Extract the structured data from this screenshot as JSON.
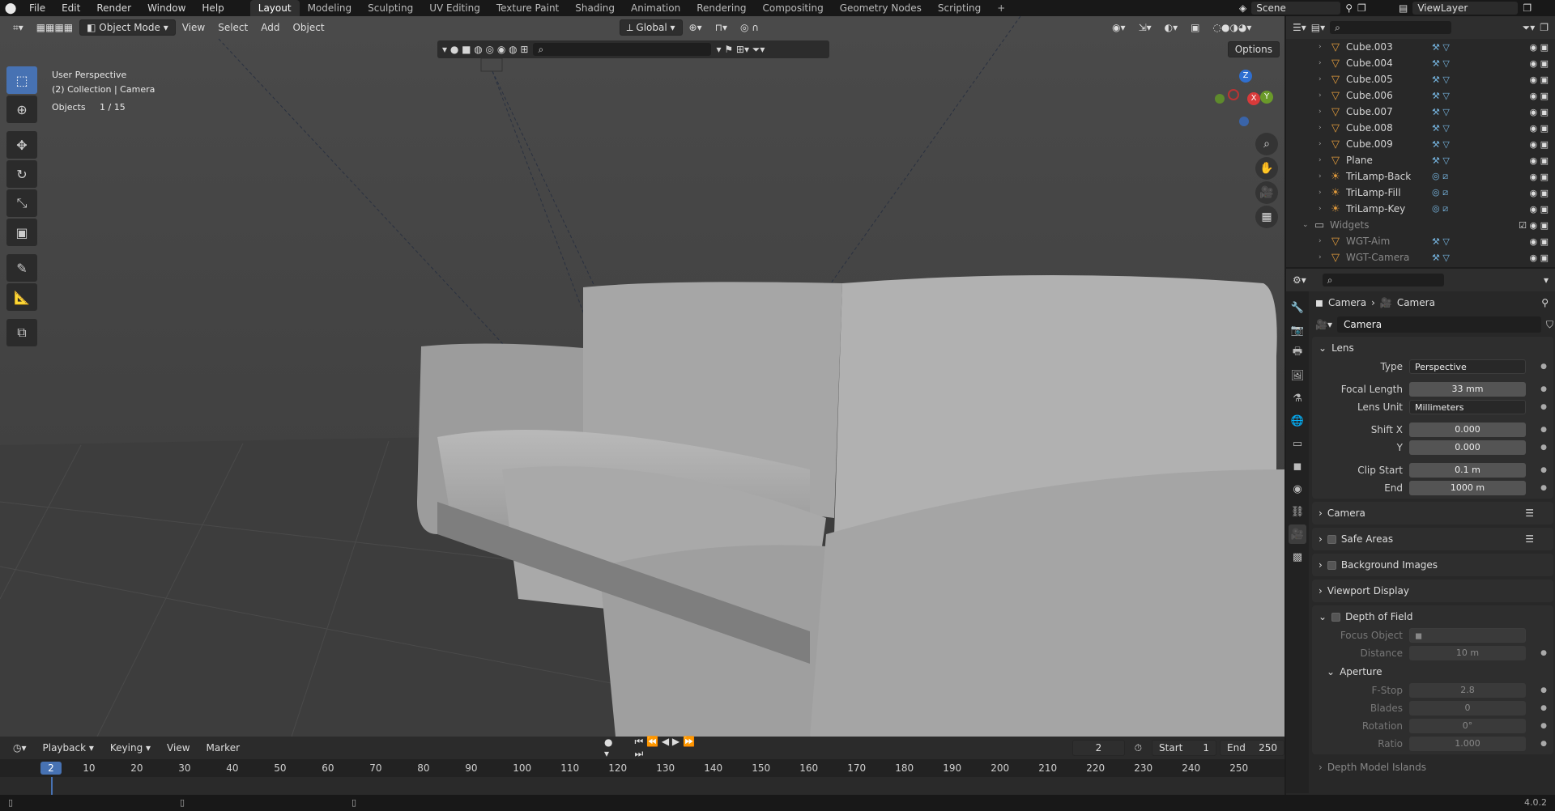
{
  "topbar": {
    "menus": [
      "File",
      "Edit",
      "Render",
      "Window",
      "Help"
    ],
    "workspaces": [
      "Layout",
      "Modeling",
      "Sculpting",
      "UV Editing",
      "Texture Paint",
      "Shading",
      "Animation",
      "Rendering",
      "Compositing",
      "Geometry Nodes",
      "Scripting"
    ],
    "active_workspace": "Layout",
    "scene": "Scene",
    "view_layer": "ViewLayer"
  },
  "viewport": {
    "mode": "Object Mode",
    "menus": [
      "View",
      "Select",
      "Add",
      "Object"
    ],
    "orientation": "Global",
    "overlay_text": {
      "perspective": "User Perspective",
      "context": "(2) Collection | Camera",
      "objects_label": "Objects",
      "objects_count": "1 / 15"
    },
    "options": "Options",
    "gizmo": {
      "z": "Z",
      "y": "Y",
      "x": "X"
    }
  },
  "outliner": {
    "rows": [
      {
        "name": "Cube.003",
        "kind": "mesh"
      },
      {
        "name": "Cube.004",
        "kind": "mesh"
      },
      {
        "name": "Cube.005",
        "kind": "mesh"
      },
      {
        "name": "Cube.006",
        "kind": "mesh"
      },
      {
        "name": "Cube.007",
        "kind": "mesh"
      },
      {
        "name": "Cube.008",
        "kind": "mesh"
      },
      {
        "name": "Cube.009",
        "kind": "mesh"
      },
      {
        "name": "Plane",
        "kind": "mesh"
      },
      {
        "name": "TriLamp-Back",
        "kind": "light"
      },
      {
        "name": "TriLamp-Fill",
        "kind": "light"
      },
      {
        "name": "TriLamp-Key",
        "kind": "light"
      },
      {
        "name": "Widgets",
        "kind": "collection"
      },
      {
        "name": "WGT-Aim",
        "kind": "mesh"
      },
      {
        "name": "WGT-Camera",
        "kind": "mesh"
      }
    ]
  },
  "properties": {
    "breadcrumb": [
      "Camera",
      "Camera"
    ],
    "datablock": "Camera",
    "lens": {
      "title": "Lens",
      "type_label": "Type",
      "type_value": "Perspective",
      "focal_label": "Focal Length",
      "focal_value": "33 mm",
      "unit_label": "Lens Unit",
      "unit_value": "Millimeters",
      "shiftx_label": "Shift X",
      "shiftx_value": "0.000",
      "shifty_label": "Y",
      "shifty_value": "0.000",
      "clipstart_label": "Clip Start",
      "clipstart_value": "0.1 m",
      "clipend_label": "End",
      "clipend_value": "1000 m"
    },
    "panels": [
      "Camera",
      "Safe Areas",
      "Background Images",
      "Viewport Display"
    ],
    "dof": {
      "title": "Depth of Field",
      "focus_label": "Focus Object",
      "distance_label": "Distance",
      "distance_value": "10 m",
      "aperture_title": "Aperture",
      "fstop_label": "F-Stop",
      "fstop_value": "2.8",
      "blades_label": "Blades",
      "blades_value": "0",
      "rotation_label": "Rotation",
      "rotation_value": "0°",
      "ratio_label": "Ratio",
      "ratio_value": "1.000"
    },
    "cutoff_panel": "Depth Model Islands"
  },
  "timeline": {
    "menus": [
      "Playback",
      "Keying",
      "View",
      "Marker"
    ],
    "current_frame": "2",
    "start_label": "Start",
    "start_value": "1",
    "end_label": "End",
    "end_value": "250",
    "ticks": [
      "10",
      "20",
      "30",
      "40",
      "50",
      "60",
      "70",
      "80",
      "90",
      "100",
      "110",
      "120",
      "130",
      "140",
      "150",
      "160",
      "170",
      "180",
      "190",
      "200",
      "210",
      "220",
      "230",
      "240",
      "250"
    ]
  },
  "status": {
    "version": "4.0.2"
  }
}
